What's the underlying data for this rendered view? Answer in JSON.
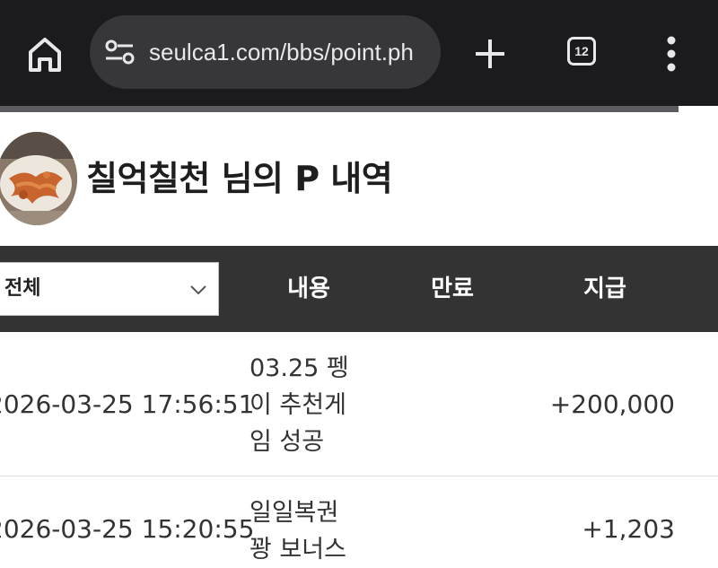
{
  "browser": {
    "url": "seulca1.com/bbs/point.ph",
    "tab_count": "12"
  },
  "header": {
    "title": "칠억칠천 님의 P 내역"
  },
  "table": {
    "filter_selected": "전체",
    "columns": [
      "내용",
      "만료",
      "지급"
    ],
    "rows": [
      {
        "date": "2026-03-25 17:56:51",
        "content": "03.25 펭이 추천게임 성공",
        "expiry": "",
        "amount": "+200,000"
      },
      {
        "date": "2026-03-25 15:20:55",
        "content": "일일복권 꽝 보너스",
        "expiry": "",
        "amount": "+1,203"
      }
    ]
  },
  "colors": {
    "browser_bg": "#1b1b1f",
    "urlbar_bg": "#37373b",
    "table_header_bg": "#333333"
  }
}
